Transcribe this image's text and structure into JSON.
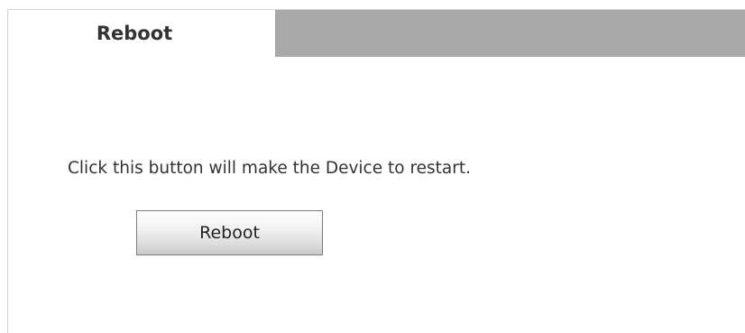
{
  "tabs": [
    {
      "label": "Reboot",
      "active": true
    }
  ],
  "main": {
    "message": "Click this button will make the Device to restart.",
    "reboot_button_label": "Reboot"
  },
  "colors": {
    "tab_filler": "#a9a9a9",
    "text": "#333333",
    "background": "#ffffff"
  }
}
